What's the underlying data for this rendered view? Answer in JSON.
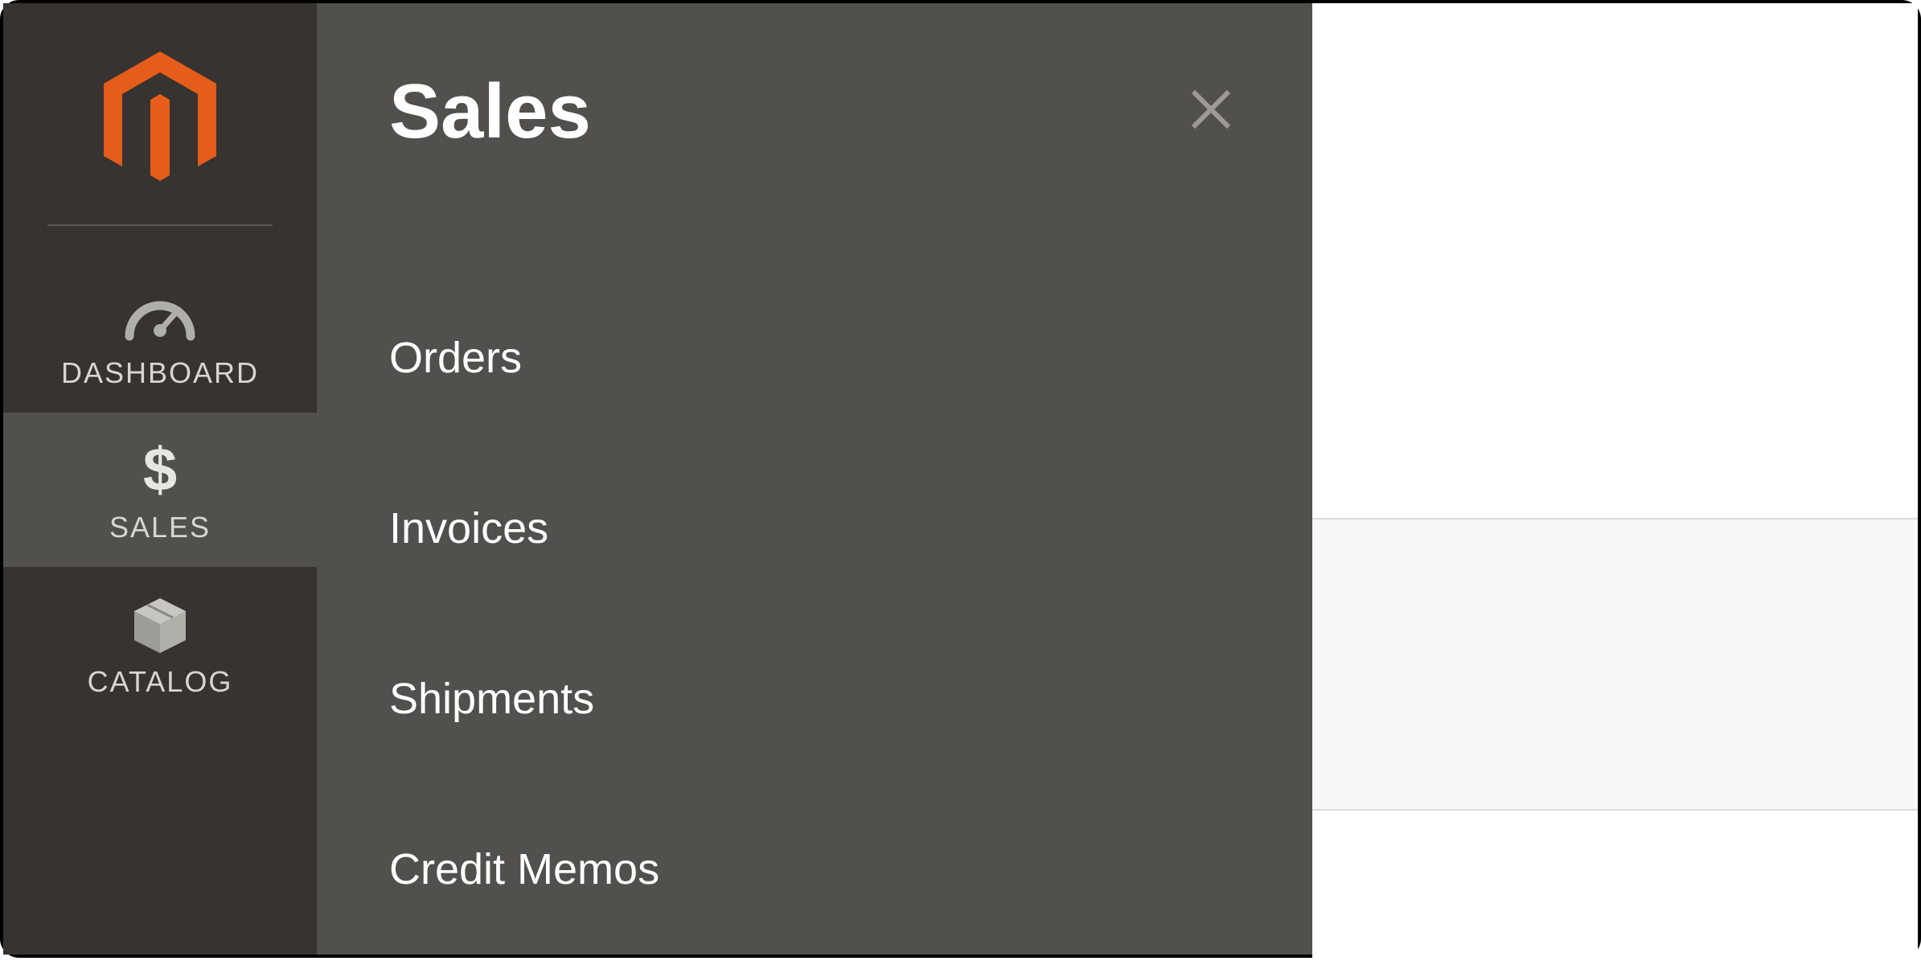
{
  "sidebar": {
    "items": [
      {
        "label": "DASHBOARD",
        "icon": "dashboard-icon"
      },
      {
        "label": "SALES",
        "icon": "dollar-icon"
      },
      {
        "label": "CATALOG",
        "icon": "box-icon"
      }
    ]
  },
  "flyout": {
    "title": "Sales",
    "items": [
      {
        "label": "Orders"
      },
      {
        "label": "Invoices"
      },
      {
        "label": "Shipments"
      },
      {
        "label": "Credit Memos"
      }
    ]
  }
}
